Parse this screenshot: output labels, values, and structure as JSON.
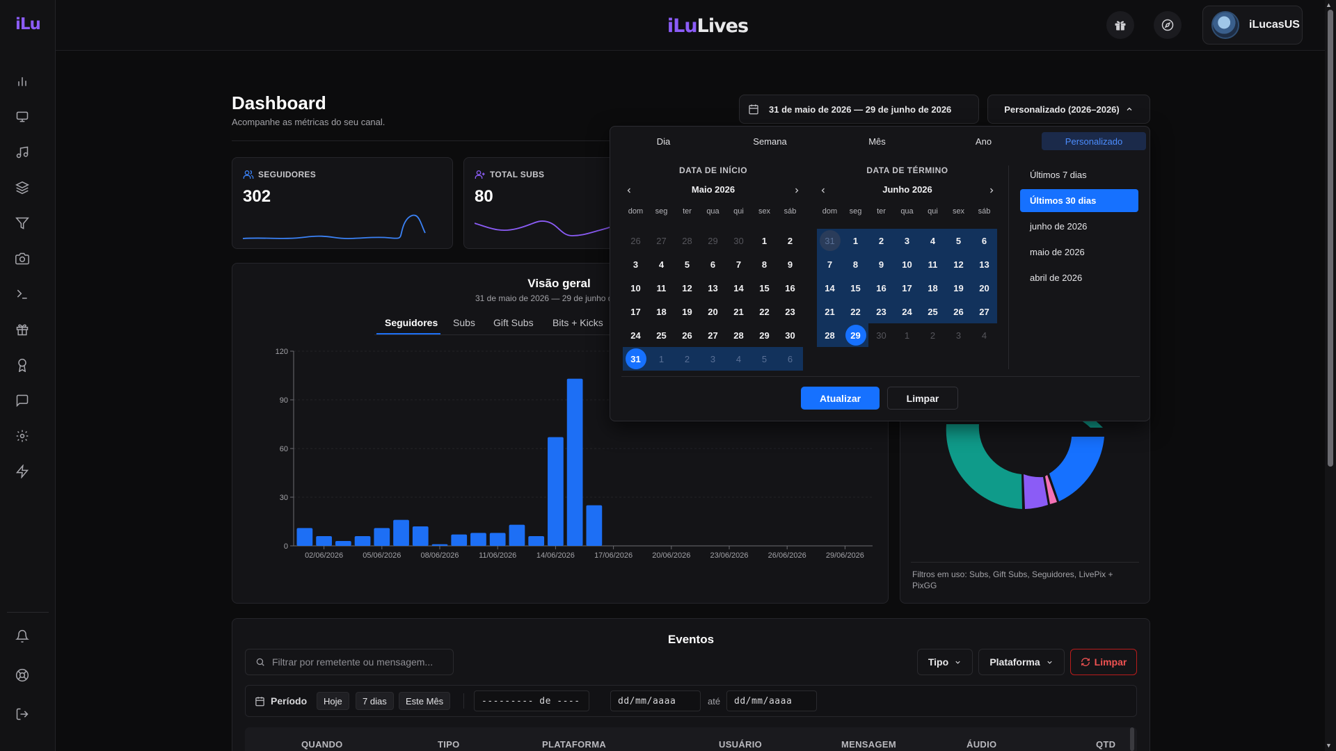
{
  "sidebar": {
    "logo": "iLu",
    "icons": [
      "bar-chart-icon",
      "monitor-icon",
      "music-icon",
      "layers-icon",
      "filter-icon",
      "camera-icon",
      "terminal-icon",
      "gift-icon",
      "award-icon",
      "message-icon",
      "settings-icon",
      "zap-icon"
    ],
    "bottom_icons": [
      "bell-icon",
      "help-circle-icon",
      "logout-icon"
    ]
  },
  "topbar": {
    "brand_a": "iLu",
    "brand_b": "Lives",
    "username": "iLucasUS"
  },
  "header": {
    "title": "Dashboard",
    "subtitle": "Acompanhe as métricas do seu canal."
  },
  "cards": [
    {
      "label": "SEGUIDORES",
      "value": "302",
      "color": "#3b82f6"
    },
    {
      "label": "TOTAL SUBS",
      "value": "80",
      "color": "#8b5cf6"
    }
  ],
  "date_range": {
    "label": "31 de maio de 2026 — 29 de junho de 2026",
    "preset_label": "Personalizado (2026–2026)"
  },
  "picker": {
    "tabs": [
      "Dia",
      "Semana",
      "Mês",
      "Ano",
      "Personalizado"
    ],
    "active_tab": 4,
    "start": {
      "title": "DATA DE INÍCIO",
      "month": "Maio 2026",
      "weekdays": [
        "dom",
        "seg",
        "ter",
        "qua",
        "qui",
        "sex",
        "sáb"
      ],
      "days": [
        [
          "26",
          "27",
          "28",
          "29",
          "30",
          "1",
          "2"
        ],
        [
          "3",
          "4",
          "5",
          "6",
          "7",
          "8",
          "9"
        ],
        [
          "10",
          "11",
          "12",
          "13",
          "14",
          "15",
          "16"
        ],
        [
          "17",
          "18",
          "19",
          "20",
          "21",
          "22",
          "23"
        ],
        [
          "24",
          "25",
          "26",
          "27",
          "28",
          "29",
          "30"
        ],
        [
          "31",
          "1",
          "2",
          "3",
          "4",
          "5",
          "6"
        ]
      ]
    },
    "end": {
      "title": "DATA DE TÉRMINO",
      "month": "Junho 2026",
      "weekdays": [
        "dom",
        "seg",
        "ter",
        "qua",
        "qui",
        "sex",
        "sáb"
      ],
      "days": [
        [
          "31",
          "1",
          "2",
          "3",
          "4",
          "5",
          "6"
        ],
        [
          "7",
          "8",
          "9",
          "10",
          "11",
          "12",
          "13"
        ],
        [
          "14",
          "15",
          "16",
          "17",
          "18",
          "19",
          "20"
        ],
        [
          "21",
          "22",
          "23",
          "24",
          "25",
          "26",
          "27"
        ],
        [
          "28",
          "29",
          "30",
          "1",
          "2",
          "3",
          "4"
        ]
      ]
    },
    "quick_ranges": [
      "Últimos 7 dias",
      "Últimos 30 dias",
      "junho de 2026",
      "maio de 2026",
      "abril de 2026"
    ],
    "active_quick": 1,
    "update_label": "Atualizar",
    "clear_label": "Limpar"
  },
  "overview": {
    "title": "Visão geral",
    "subtitle": "31 de maio de 2026 — 29 de junho de 2026",
    "tabs": [
      "Seguidores",
      "Subs",
      "Gift Subs",
      "Bits + Kicks"
    ],
    "active_tab": 0
  },
  "chart_data": {
    "type": "bar",
    "title": "Visão geral",
    "series": [
      {
        "name": "Seguidores",
        "color": "#1d6ff5"
      }
    ],
    "x_ticks": [
      "02/06/2026",
      "05/06/2026",
      "08/06/2026",
      "11/06/2026",
      "14/06/2026",
      "17/06/2026",
      "20/06/2026",
      "23/06/2026",
      "26/06/2026",
      "29/06/2026"
    ],
    "y_ticks": [
      0,
      30,
      60,
      90,
      120
    ],
    "ylim": [
      0,
      120
    ],
    "values": [
      11,
      6,
      3,
      6,
      11,
      16,
      12,
      1,
      7,
      8,
      8,
      13,
      6,
      67,
      103,
      25,
      0,
      0,
      0,
      0,
      0,
      0,
      0,
      0,
      0,
      0,
      0,
      0,
      0,
      0
    ],
    "grid": true
  },
  "donut": {
    "filters_text": "Filtros em uso: Subs, Gift Subs, Seguidores, LivePix + PixGG"
  },
  "events": {
    "title": "Eventos",
    "search_placeholder": "Filtrar por remetente ou mensagem...",
    "type_label": "Tipo",
    "platform_label": "Plataforma",
    "clear_label": "Limpar",
    "period_label": "Período",
    "chips": [
      "Hoje",
      "7 dias",
      "Este Mês"
    ],
    "month_input": "--------- de ----",
    "date_from": "dd/mm/aaaa",
    "until": "até",
    "date_to": "dd/mm/aaaa",
    "columns": [
      "QUANDO",
      "TIPO",
      "PLATAFORMA",
      "USUÁRIO",
      "MENSAGEM",
      "ÁUDIO",
      "QTD"
    ]
  }
}
